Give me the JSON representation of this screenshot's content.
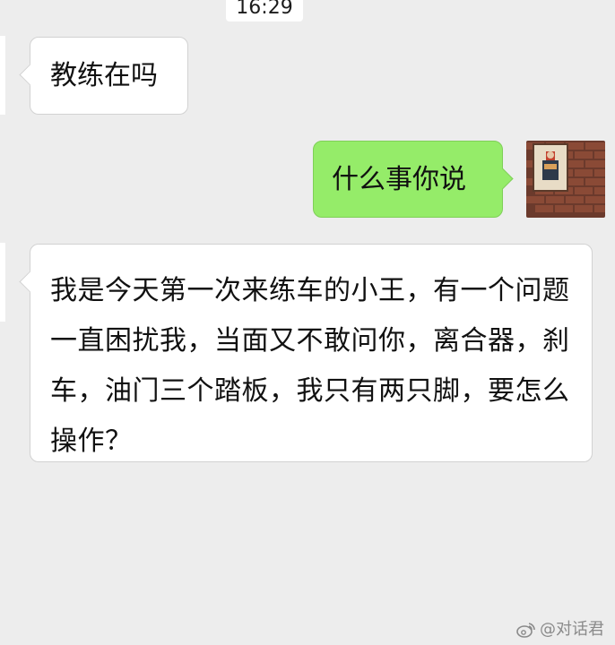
{
  "status": {
    "time": "16:29"
  },
  "messages": [
    {
      "from": "contact",
      "text": "教练在吗"
    },
    {
      "from": "self",
      "text": "什么事你说"
    },
    {
      "from": "contact",
      "text": "我是今天第一次来练车的小王，有一个问题一直困扰我，当面又不敢问你，离合器，刹车，油门三个踏板，我只有两只脚，要怎么操作？"
    }
  ],
  "watermark": {
    "text": "@对话君",
    "icon": "weibo-icon"
  },
  "colors": {
    "background": "#ededed",
    "incoming_bubble": "#ffffff",
    "outgoing_bubble": "#95ec69"
  }
}
